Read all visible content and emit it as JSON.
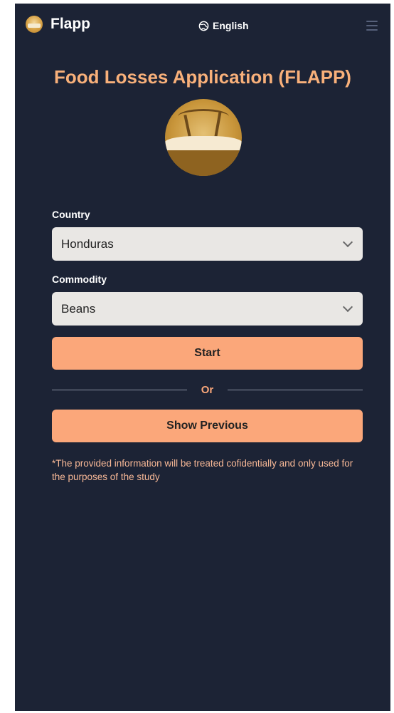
{
  "navbar": {
    "brand": "Flapp",
    "language": "English",
    "icons": {
      "logo": "flapp-logo-icon",
      "globe": "globe-icon",
      "menu": "hamburger-menu-icon"
    }
  },
  "title": "Food Losses Application (FLAPP)",
  "form": {
    "country_label": "Country",
    "country_value": "Honduras",
    "commodity_label": "Commodity",
    "commodity_value": "Beans",
    "start_label": "Start",
    "or_label": "Or",
    "show_previous_label": "Show Previous",
    "note": "*The provided information will be treated cofidentially and only used for the purposes of the study"
  },
  "colors": {
    "background": "#1c2335",
    "accent": "#fba77a",
    "title": "#f8b07a",
    "field": "#e9e7e4"
  }
}
